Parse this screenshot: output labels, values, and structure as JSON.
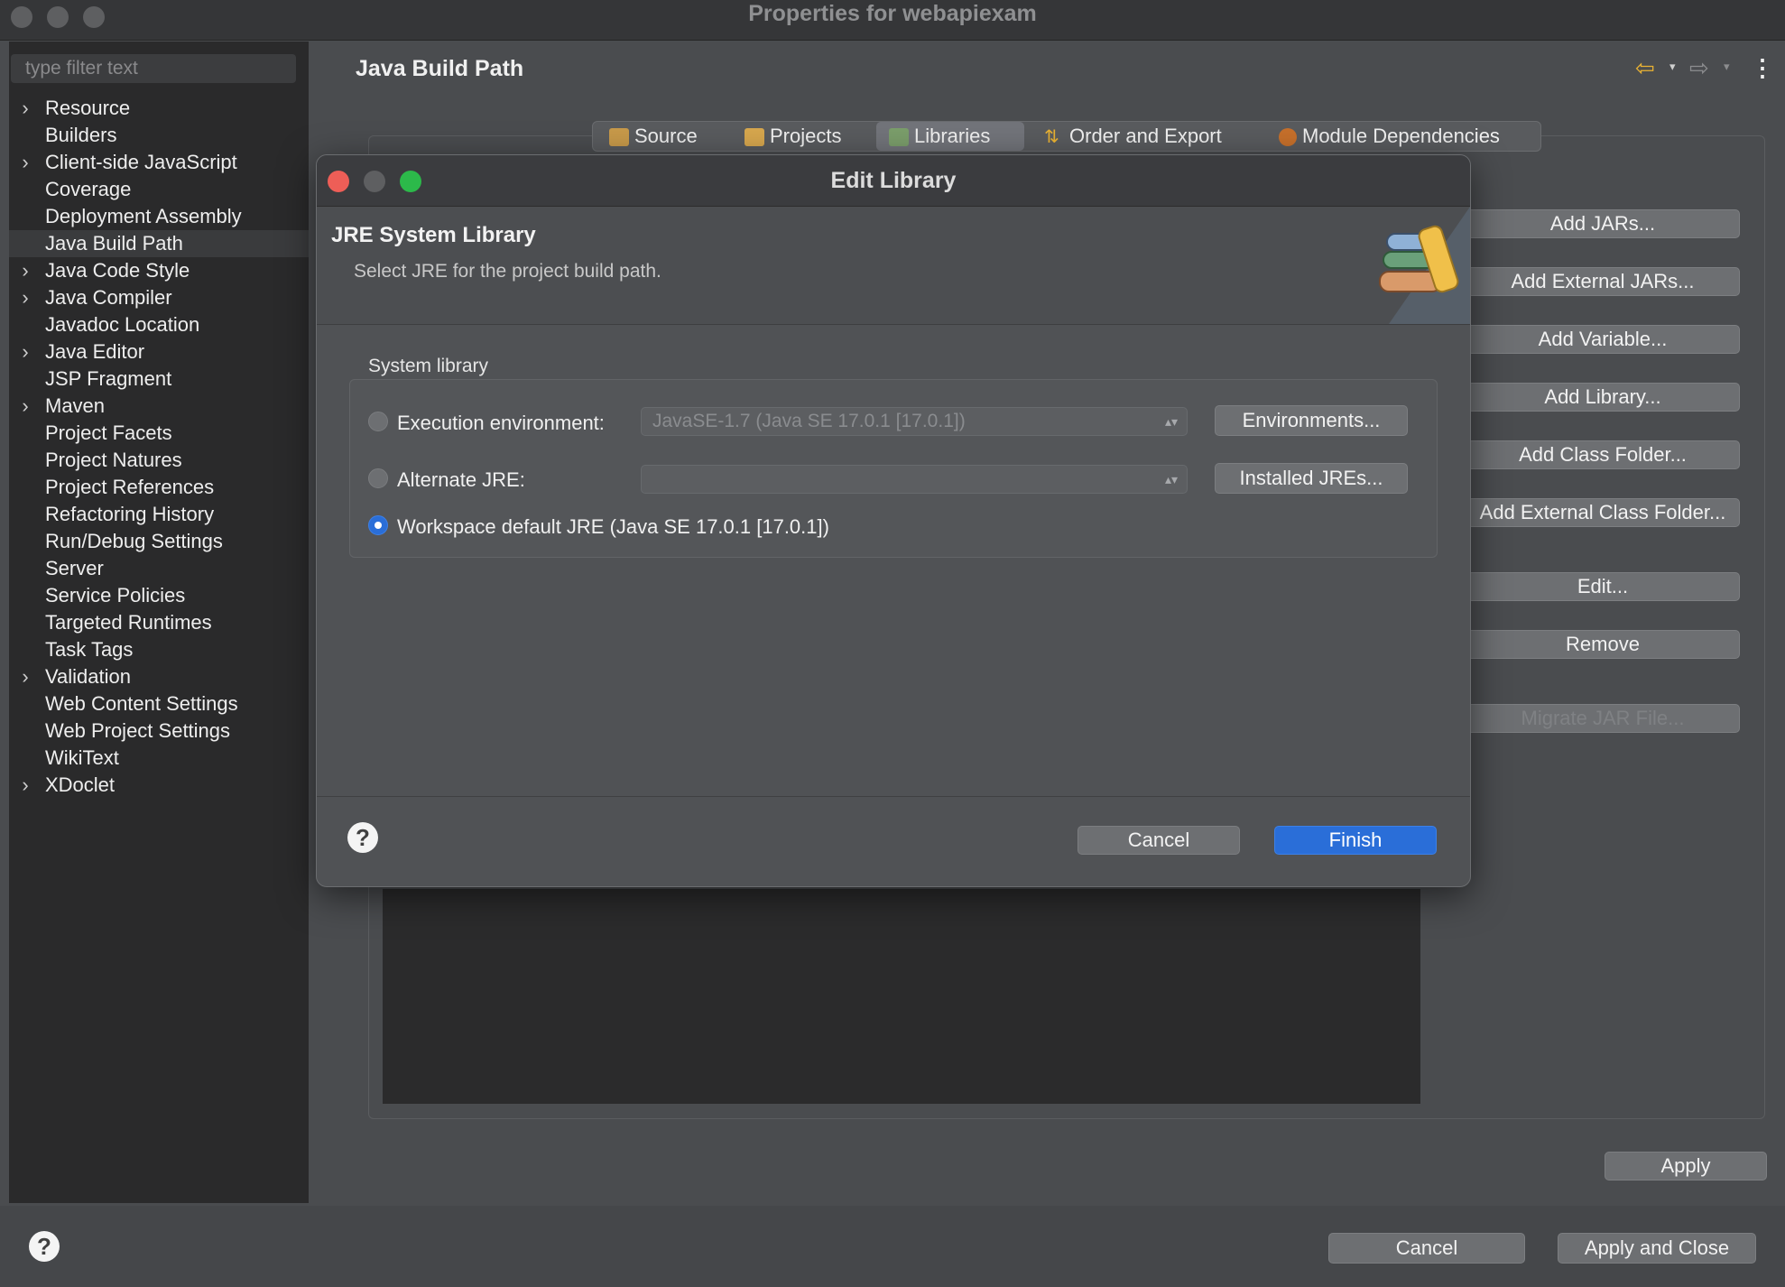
{
  "window": {
    "title": "Properties for webapiexam"
  },
  "sidebar": {
    "filter_placeholder": "type filter text",
    "items": [
      {
        "label": "Resource",
        "expandable": true
      },
      {
        "label": "Builders",
        "expandable": false
      },
      {
        "label": "Client-side JavaScript",
        "expandable": true
      },
      {
        "label": "Coverage",
        "expandable": false
      },
      {
        "label": "Deployment Assembly",
        "expandable": false
      },
      {
        "label": "Java Build Path",
        "expandable": false,
        "selected": true
      },
      {
        "label": "Java Code Style",
        "expandable": true
      },
      {
        "label": "Java Compiler",
        "expandable": true
      },
      {
        "label": "Javadoc Location",
        "expandable": false
      },
      {
        "label": "Java Editor",
        "expandable": true
      },
      {
        "label": "JSP Fragment",
        "expandable": false
      },
      {
        "label": "Maven",
        "expandable": true
      },
      {
        "label": "Project Facets",
        "expandable": false
      },
      {
        "label": "Project Natures",
        "expandable": false
      },
      {
        "label": "Project References",
        "expandable": false
      },
      {
        "label": "Refactoring History",
        "expandable": false
      },
      {
        "label": "Run/Debug Settings",
        "expandable": false
      },
      {
        "label": "Server",
        "expandable": false
      },
      {
        "label": "Service Policies",
        "expandable": false
      },
      {
        "label": "Targeted Runtimes",
        "expandable": false
      },
      {
        "label": "Task Tags",
        "expandable": false
      },
      {
        "label": "Validation",
        "expandable": true
      },
      {
        "label": "Web Content Settings",
        "expandable": false
      },
      {
        "label": "Web Project Settings",
        "expandable": false
      },
      {
        "label": "WikiText",
        "expandable": false
      },
      {
        "label": "XDoclet",
        "expandable": true
      }
    ]
  },
  "page": {
    "title": "Java Build Path",
    "tabs": [
      {
        "label": "Source",
        "icon": "source-folder-icon"
      },
      {
        "label": "Projects",
        "icon": "projects-folder-icon"
      },
      {
        "label": "Libraries",
        "icon": "libraries-icon",
        "active": true
      },
      {
        "label": "Order and Export",
        "icon": "order-export-icon"
      },
      {
        "label": "Module Dependencies",
        "icon": "module-icon"
      }
    ],
    "side_buttons": {
      "add_jars": "Add JARs...",
      "add_external_jars": "Add External JARs...",
      "add_variable": "Add Variable...",
      "add_library": "Add Library...",
      "add_class_folder": "Add Class Folder...",
      "add_external_class_folder": "Add External Class Folder...",
      "edit": "Edit...",
      "remove": "Remove",
      "migrate_jar": "Migrate JAR File..."
    },
    "apply": "Apply"
  },
  "footer": {
    "cancel": "Cancel",
    "apply_close": "Apply and Close"
  },
  "dialog": {
    "title": "Edit Library",
    "header_title": "JRE System Library",
    "header_desc": "Select JRE for the project build path.",
    "group_label": "System library",
    "exec_env_label": "Execution environment:",
    "exec_env_value": "JavaSE-1.7 (Java SE 17.0.1 [17.0.1])",
    "environments_button": "Environments...",
    "alt_jre_label": "Alternate JRE:",
    "alt_jre_value": "",
    "installed_jres_button": "Installed JREs...",
    "workspace_label": "Workspace default JRE (Java SE 17.0.1 [17.0.1])",
    "selected_option": "workspace",
    "cancel": "Cancel",
    "finish": "Finish"
  },
  "colors": {
    "accent": "#2a6ed8",
    "close": "#ee5e57",
    "zoom": "#2cb94a",
    "arrow": "#e9b233"
  }
}
